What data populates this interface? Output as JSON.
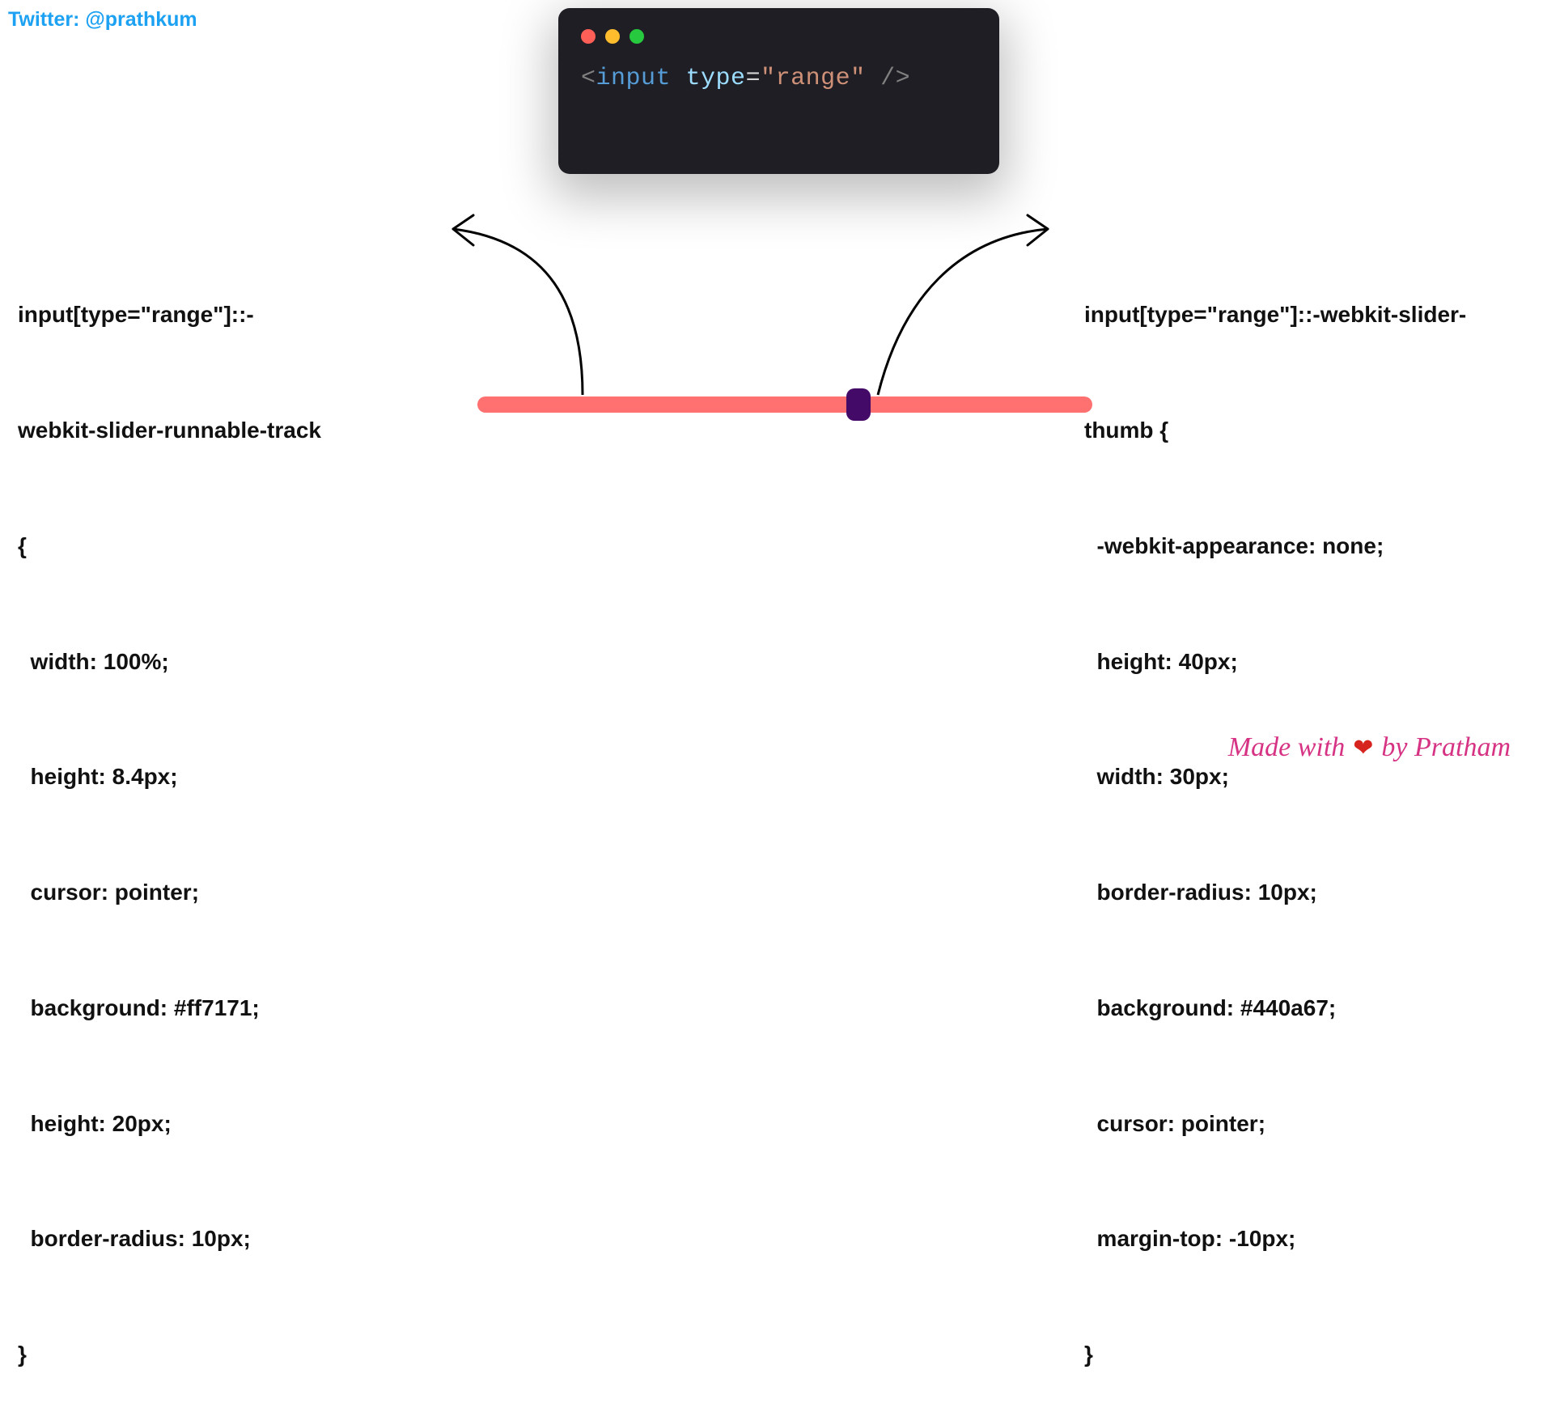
{
  "twitter_handle": "Twitter: @prathkum",
  "code": {
    "angle_open": "<",
    "tag": "input",
    "attr": "type",
    "eq": "=",
    "str": "\"range\"",
    "close": " />"
  },
  "css_track": {
    "selector1": "input[type=\"range\"]::-",
    "selector2": "webkit-slider-runnable-track",
    "open": "{",
    "p1": "  width: 100%;",
    "p2": "  height: 8.4px;",
    "p3": "  cursor: pointer;",
    "p4": "  background: #ff7171;",
    "p5": "  height: 20px;",
    "p6": "  border-radius: 10px;",
    "close": "}"
  },
  "css_thumb": {
    "selector1": "input[type=\"range\"]::-webkit-slider-",
    "selector2": "thumb {",
    "p1": "  -webkit-appearance: none;",
    "p2": "  height: 40px;",
    "p3": "  width: 30px;",
    "p4": "  border-radius: 10px;",
    "p5": "  background: #440a67;",
    "p6": "  cursor: pointer;",
    "p7": "  margin-top: -10px;",
    "close": "}"
  },
  "slider": {
    "track_color": "#ff7171",
    "thumb_color": "#440a67"
  },
  "footer": {
    "prefix": "Made with",
    "suffix": "by Pratham"
  }
}
